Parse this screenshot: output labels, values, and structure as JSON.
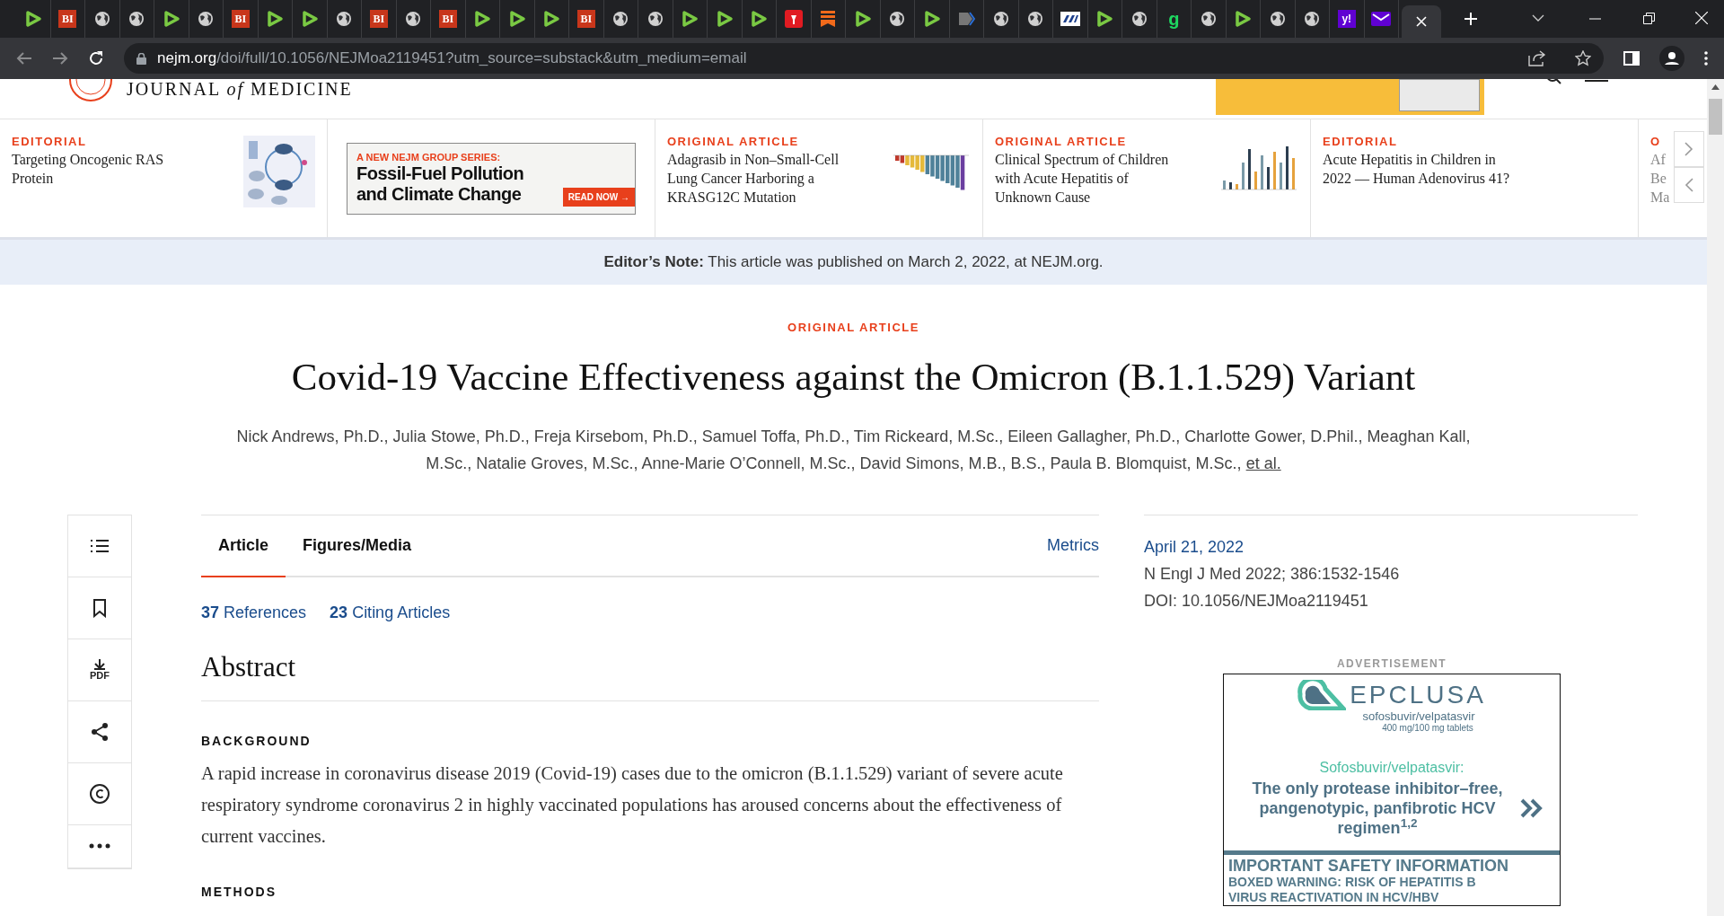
{
  "browser": {
    "tabs": [
      {
        "kind": "play"
      },
      {
        "kind": "bi",
        "label": "BI"
      },
      {
        "kind": "globe"
      },
      {
        "kind": "globe"
      },
      {
        "kind": "play"
      },
      {
        "kind": "globe"
      },
      {
        "kind": "bi",
        "label": "BI"
      },
      {
        "kind": "play"
      },
      {
        "kind": "play"
      },
      {
        "kind": "globe"
      },
      {
        "kind": "bi",
        "label": "BI"
      },
      {
        "kind": "globe"
      },
      {
        "kind": "bi",
        "label": "BI"
      },
      {
        "kind": "play"
      },
      {
        "kind": "play"
      },
      {
        "kind": "play"
      },
      {
        "kind": "bi",
        "label": "BI"
      },
      {
        "kind": "globe"
      },
      {
        "kind": "globe"
      },
      {
        "kind": "play"
      },
      {
        "kind": "play"
      },
      {
        "kind": "play"
      },
      {
        "kind": "torch"
      },
      {
        "kind": "bookmark"
      },
      {
        "kind": "play"
      },
      {
        "kind": "globe"
      },
      {
        "kind": "play"
      },
      {
        "kind": "arrow"
      },
      {
        "kind": "globe"
      },
      {
        "kind": "globe"
      },
      {
        "kind": "stripes"
      },
      {
        "kind": "play"
      },
      {
        "kind": "globe"
      },
      {
        "kind": "letter",
        "label": "g"
      },
      {
        "kind": "globe"
      },
      {
        "kind": "play"
      },
      {
        "kind": "globe"
      },
      {
        "kind": "globe"
      },
      {
        "kind": "yahoo",
        "label": "y!"
      },
      {
        "kind": "mail"
      },
      {
        "kind": "active"
      }
    ],
    "address": {
      "domain": "nejm.org",
      "path": "/doi/full/10.1056/NEJMoa2119451?utm_source=substack&utm_medium=email"
    }
  },
  "header": {
    "logo": "JOURNAL *of* MEDICINE"
  },
  "carousel": [
    {
      "kind": "article",
      "kicker": "EDITORIAL",
      "lines": [
        "Targeting Oncogenic RAS",
        "Protein"
      ],
      "thumbnail": {
        "kind": "diagram"
      }
    },
    {
      "kind": "promo",
      "kicker": "A NEW NEJM GROUP SERIES:",
      "lines": [
        "Fossil-Fuel Pollution",
        "and Climate Change"
      ],
      "button": "READ NOW →"
    },
    {
      "kind": "article",
      "kicker": "ORIGINAL ARTICLE",
      "lines": [
        "Adagrasib in Non–Small-Cell",
        "Lung Cancer Harboring a",
        "KRASG12C Mutation"
      ],
      "thumbnail": {
        "kind": "waterfall"
      }
    },
    {
      "kind": "article",
      "kicker": "ORIGINAL ARTICLE",
      "lines": [
        "Clinical Spectrum of Children",
        "with Acute Hepatitis of",
        "Unknown Cause"
      ],
      "thumbnail": {
        "kind": "bars"
      }
    },
    {
      "kind": "article",
      "kicker": "EDITORIAL",
      "lines": [
        "Acute Hepatitis in Children in",
        "2022 — Human Adenovirus 41?"
      ]
    },
    {
      "kind": "partial",
      "kicker": "O",
      "lines": [
        "Af",
        "Be",
        "Ma"
      ]
    }
  ],
  "note": "**Editor’s Note:** This article was published on March 2, 2022, at NEJM.org.",
  "article": {
    "kicker": "ORIGINAL ARTICLE",
    "title": "Covid-19 Vaccine Effectiveness against the Omicron (B.1.1.529) Variant",
    "authors": "Nick Andrews, Ph.D., Julia Stowe, Ph.D., Freja Kirsebom, Ph.D., Samuel Toffa, Ph.D., Tim Rickeard, M.Sc., Eileen Gallagher, Ph.D., Charlotte Gower, D.Phil., Meaghan Kall, M.Sc., Natalie Groves, M.Sc., Anne-Marie O’Connell, M.Sc., David Simons, M.B., B.S., Paula B. Blomquist, M.Sc.,",
    "et_al": "et al.",
    "tabs": [
      {
        "label": "Article",
        "selected": true
      },
      {
        "label": "Figures/Media",
        "selected": false
      }
    ],
    "metrics": "Metrics",
    "links": [
      "**37** References",
      "**23** Citing Articles"
    ],
    "abstract": "Abstract",
    "sections": [
      {
        "heading": "BACKGROUND",
        "text": "A rapid increase in coronavirus disease 2019 (Covid-19) cases due to the omicron (B.1.1.529) variant of severe acute respiratory syndrome coronavirus 2 in highly vaccinated populations has aroused concerns about the effectiveness of current vaccines."
      },
      {
        "heading": "METHODS"
      }
    ]
  },
  "tools": [
    {
      "kind": "list"
    },
    {
      "kind": "bookmark"
    },
    {
      "kind": "pdf",
      "label": "PDF"
    },
    {
      "kind": "share"
    },
    {
      "kind": "copyright"
    },
    {
      "kind": "more"
    }
  ],
  "info": {
    "date": "April 21, 2022",
    "citation": "N Engl J Med 2022; 386:1532-1546",
    "doi": "DOI: 10.1056/NEJMoa2119451"
  },
  "ad": {
    "label": "ADVERTISEMENT",
    "brand": "EPCLUSA",
    "generic": "sofosbuvir/velpatasvir",
    "dose": "400 mg/100 mg tablets",
    "subhead": "Sofosbuvir/velpatasvir:",
    "headline": "The only protease inhibitor–free, pangenotypic, panfibrotic HCV regimen$^{1,2}$",
    "isi_title": "IMPORTANT SAFETY INFORMATION",
    "isi_text": "BOXED WARNING: RISK OF HEPATITIS B VIRUS REACTIVATION IN HCV/HBV"
  }
}
